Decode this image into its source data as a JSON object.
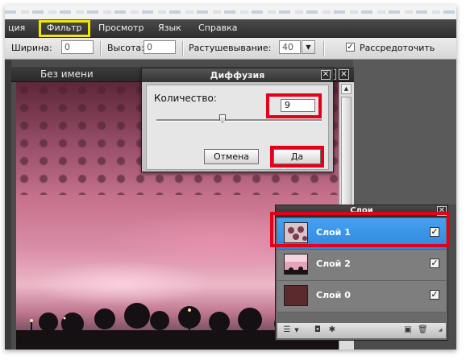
{
  "menu": {
    "items": [
      {
        "label": "ция"
      },
      {
        "label": "Фильтр"
      },
      {
        "label": "Просмотр"
      },
      {
        "label": "Язык"
      },
      {
        "label": "Справка"
      }
    ]
  },
  "options": {
    "width_label": "Ширина:",
    "width_value": "0",
    "height_label": "Высота:",
    "height_value": "0",
    "feather_label": "Растушевывание:",
    "feather_value": "40",
    "distribute_label": "Рассредоточить",
    "distribute_checked": true
  },
  "document": {
    "title": "Без имени",
    "minimize_glyph": "▭",
    "close_glyph": "✕"
  },
  "dialog": {
    "title": "Диффузия",
    "close_glyph": "✕",
    "amount_label": "Количество:",
    "amount_value": "9",
    "slider_fraction": 0.4,
    "cancel_label": "Отмена",
    "ok_label": "Да"
  },
  "layers": {
    "title": "Слои",
    "close_glyph": "✕",
    "items": [
      {
        "name": "Слой 1",
        "selected": true,
        "visible": true
      },
      {
        "name": "Слой 2",
        "selected": false,
        "visible": true
      },
      {
        "name": "Слой 0",
        "selected": false,
        "visible": true
      }
    ],
    "check_glyph": "✓"
  },
  "colors": {
    "highlight_red": "#e3001b",
    "highlight_yellow": "#f2e600",
    "selected_layer": "#3b95e8"
  },
  "icons": {
    "dropdown": "▼",
    "scroll_up": "▲"
  }
}
